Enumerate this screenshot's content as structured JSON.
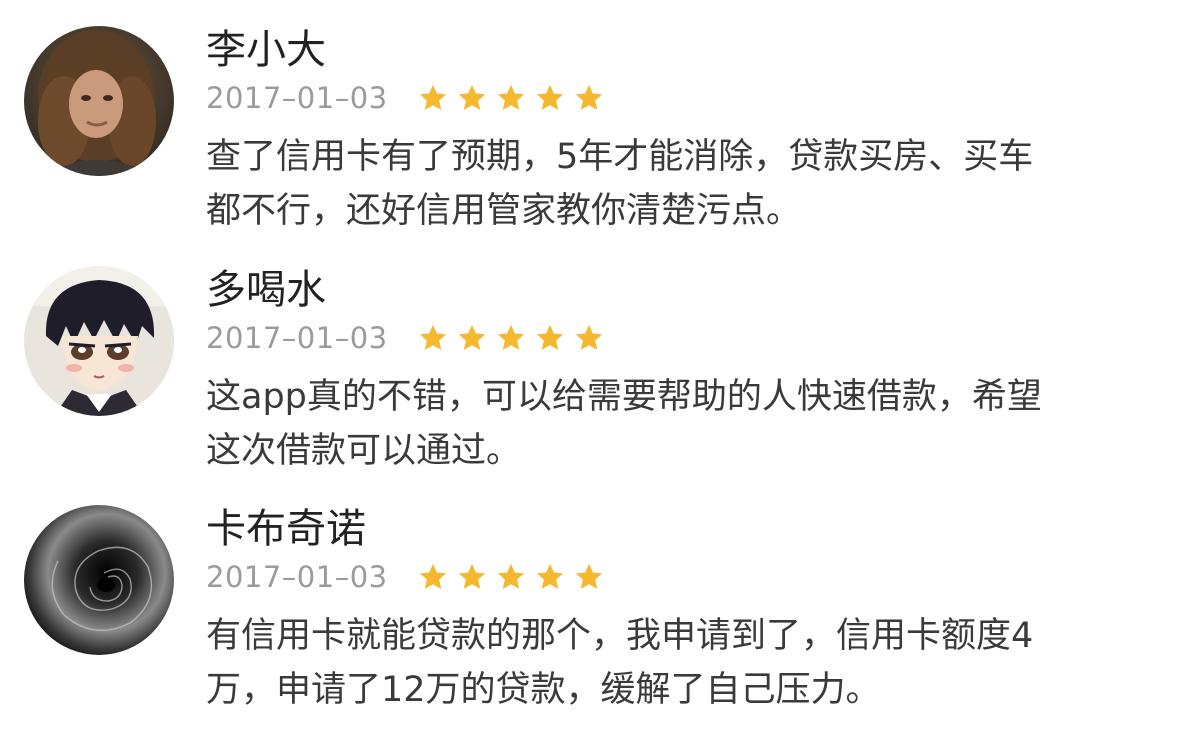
{
  "colors": {
    "star": "#f5b82e",
    "date": "#9b9b9b",
    "text": "#3a3a3a",
    "name": "#222222"
  },
  "reviews": [
    {
      "name": "李小大",
      "date": "2017–01–03",
      "rating": 5,
      "avatar": "curly-hair-woman-photo",
      "comment_lines": [
        "查了信用卡有了预期，5年才能消除，贷款买房、买车",
        "都不行，还好信用管家教你清楚污点。"
      ]
    },
    {
      "name": "多喝水",
      "date": "2017–01–03",
      "rating": 5,
      "avatar": "anime-boy-illustration",
      "comment_lines": [
        "这app真的不错，可以给需要帮助的人快速借款，希望",
        "这次借款可以通过。"
      ]
    },
    {
      "name": "卡布奇诺",
      "date": "2017–01–03",
      "rating": 5,
      "avatar": "dark-spiral-tunnel-image",
      "comment_lines": [
        "有信用卡就能贷款的那个，我申请到了，信用卡额度4",
        "万，申请了12万的贷款，缓解了自己压力。"
      ]
    }
  ]
}
